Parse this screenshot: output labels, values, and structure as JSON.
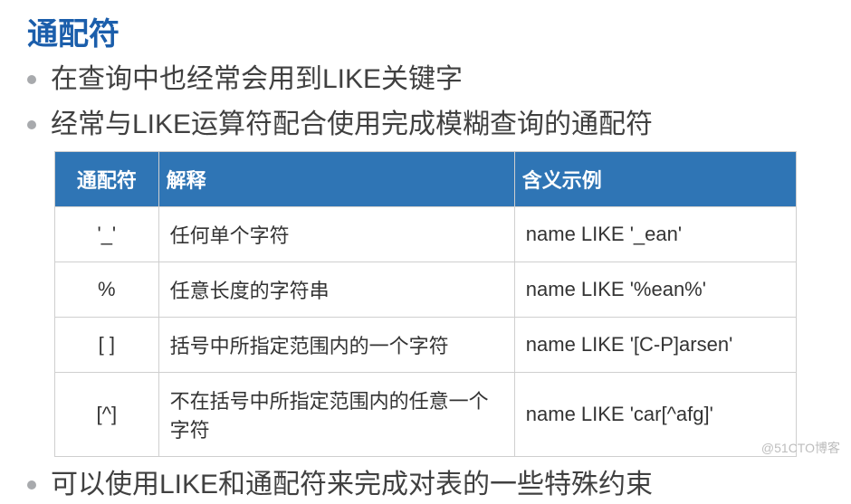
{
  "title": "通配符",
  "bullets": {
    "b1": "在查询中也经常会用到LIKE关键字",
    "b2": "经常与LIKE运算符配合使用完成模糊查询的通配符",
    "b3": "可以使用LIKE和通配符来完成对表的一些特殊约束"
  },
  "table": {
    "headers": {
      "h1": "通配符",
      "h2": "解释",
      "h3": "含义示例"
    },
    "rows": [
      {
        "c1": "'_'",
        "c2": "任何单个字符",
        "c3": "name LIKE '_ean'"
      },
      {
        "c1": "%",
        "c2": "任意长度的字符串",
        "c3": "name LIKE '%ean%'"
      },
      {
        "c1": "[ ]",
        "c2": "括号中所指定范围内的一个字符",
        "c3": "name LIKE '[C-P]arsen'"
      },
      {
        "c1": "[^]",
        "c2": "不在括号中所指定范围内的任意一个字符",
        "c3": "name LIKE 'car[^afg]'"
      }
    ]
  },
  "watermark": "@51CTO博客"
}
